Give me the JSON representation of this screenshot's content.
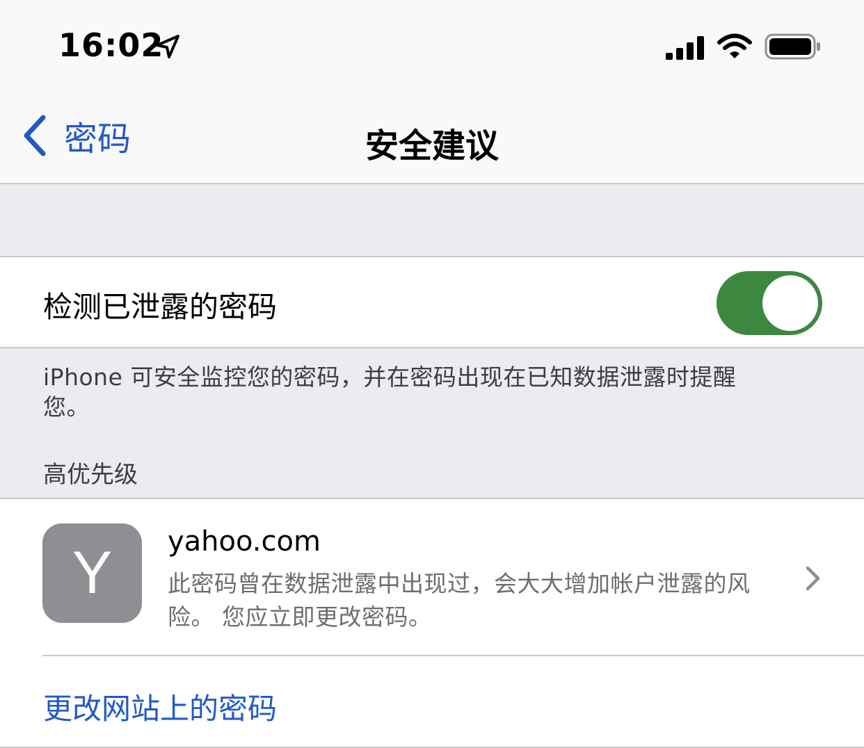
{
  "status_bar": {
    "time": "16:02",
    "icons": [
      "location-arrow-icon",
      "cellular-signal-icon",
      "wifi-icon",
      "battery-icon"
    ]
  },
  "nav": {
    "back_label": "密码",
    "title": "安全建议"
  },
  "detect_toggle": {
    "label": "检测已泄露的密码",
    "on": true
  },
  "footer_note": "iPhone 可安全监控您的密码，并在密码出现在已知数据泄露时提醒您。",
  "section_header": "高优先级",
  "recommendation": {
    "avatar_letter": "Y",
    "site": "yahoo.com",
    "description": "此密码曾在数据泄露中出现过，会大大增加帐户泄露的风险。 您应立即更改密码。"
  },
  "action_label": "更改网站上的密码",
  "colors": {
    "accent_blue": "#2259c8",
    "toggle_green": "#3d8841",
    "group_gray": "#ebebf0",
    "avatar_gray": "#8e8e93"
  }
}
